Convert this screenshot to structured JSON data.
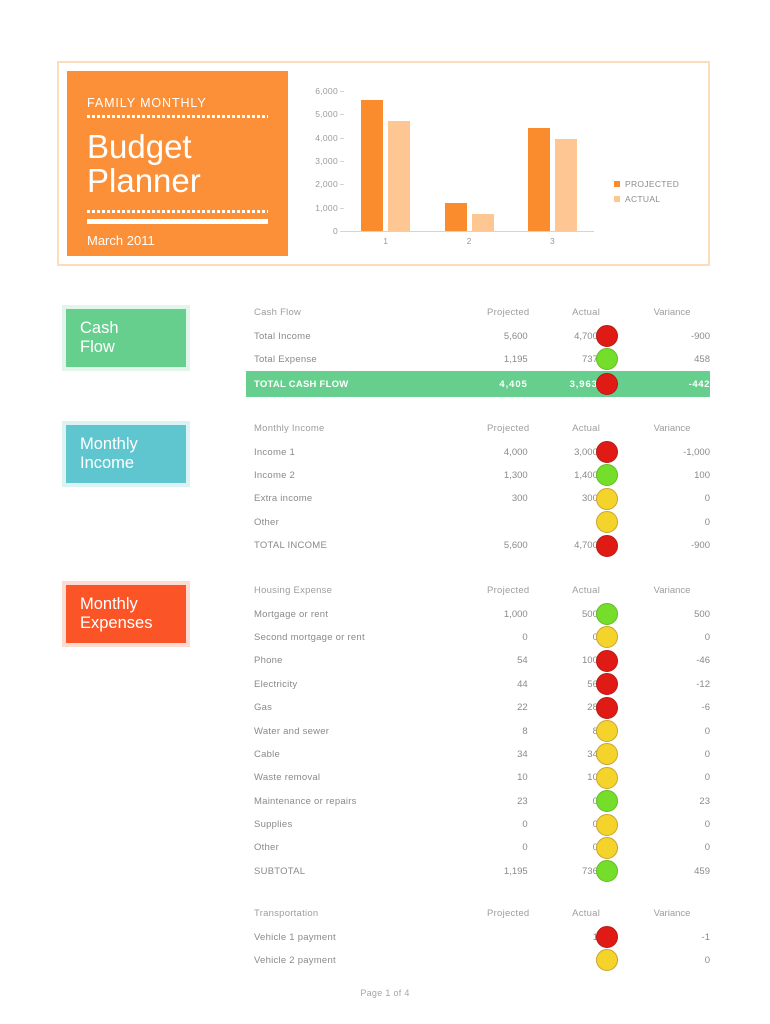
{
  "header": {
    "kicker": "FAMILY MONTHLY",
    "title_line1": "Budget",
    "title_line2": "Planner",
    "date": "March 2011"
  },
  "chart_data": {
    "type": "bar",
    "title": "",
    "xlabel": "",
    "ylabel": "",
    "categories": [
      "1",
      "2",
      "3"
    ],
    "category_meaning": [
      "Total Income",
      "Total Expense",
      "Total Cash Flow"
    ],
    "series": [
      {
        "name": "PROJECTED",
        "color": "#fb8c2d",
        "values": [
          5600,
          1195,
          4405
        ]
      },
      {
        "name": "ACTUAL",
        "color": "#fdc692",
        "values": [
          4700,
          737,
          3963
        ]
      }
    ],
    "ylim": [
      0,
      6000
    ],
    "yticks": [
      "0",
      "1,000",
      "2,000",
      "3,000",
      "4,000",
      "5,000",
      "6,000"
    ],
    "ytick_values": [
      0,
      1000,
      2000,
      3000,
      4000,
      5000,
      6000
    ],
    "grid": false,
    "legend_position": "right"
  },
  "sidebar": {
    "chips": [
      {
        "name": "cash-flow",
        "label": "Cash\nFlow",
        "color": "#66cf8e",
        "border": "#e2f5ea"
      },
      {
        "name": "monthly-income",
        "label": "Monthly\nIncome",
        "color": "#5fc6cf",
        "border": "#dcf2f3"
      },
      {
        "name": "monthly-expenses",
        "label": "Monthly\nExpenses",
        "color": "#fb5527",
        "border": "#fcdcd2"
      }
    ]
  },
  "columns": {
    "projected": "Projected",
    "actual": "Actual",
    "variance": "Variance"
  },
  "tables": {
    "cash_flow": {
      "heading": "Cash Flow",
      "rows": [
        {
          "label": "Total Income",
          "projected": "5,600",
          "actual": "4,700",
          "indicator": "red",
          "variance": "-900"
        },
        {
          "label": "Total Expense",
          "projected": "1,195",
          "actual": "737",
          "indicator": "green",
          "variance": "458"
        }
      ],
      "total": {
        "label": "TOTAL CASH FLOW",
        "projected": "4,405",
        "actual": "3,963",
        "indicator": "red",
        "variance": "-442"
      }
    },
    "monthly_income": {
      "heading": "Monthly Income",
      "rows": [
        {
          "label": "Income 1",
          "projected": "4,000",
          "actual": "3,000",
          "indicator": "red",
          "variance": "-1,000"
        },
        {
          "label": "Income 2",
          "projected": "1,300",
          "actual": "1,400",
          "indicator": "green",
          "variance": "100"
        },
        {
          "label": "Extra income",
          "projected": "300",
          "actual": "300",
          "indicator": "yellow",
          "variance": "0"
        },
        {
          "label": "Other",
          "projected": "",
          "actual": "",
          "indicator": "yellow",
          "variance": "0"
        },
        {
          "label": "TOTAL INCOME",
          "projected": "5,600",
          "actual": "4,700",
          "indicator": "red",
          "variance": "-900"
        }
      ]
    },
    "housing_expense": {
      "heading": "Housing Expense",
      "rows": [
        {
          "label": "Mortgage or rent",
          "projected": "1,000",
          "actual": "500",
          "indicator": "green",
          "variance": "500"
        },
        {
          "label": "Second mortgage or rent",
          "projected": "0",
          "actual": "0",
          "indicator": "yellow",
          "variance": "0"
        },
        {
          "label": "Phone",
          "projected": "54",
          "actual": "100",
          "indicator": "red",
          "variance": "-46"
        },
        {
          "label": "Electricity",
          "projected": "44",
          "actual": "56",
          "indicator": "red",
          "variance": "-12"
        },
        {
          "label": "Gas",
          "projected": "22",
          "actual": "28",
          "indicator": "red",
          "variance": "-6"
        },
        {
          "label": "Water and sewer",
          "projected": "8",
          "actual": "8",
          "indicator": "yellow",
          "variance": "0"
        },
        {
          "label": "Cable",
          "projected": "34",
          "actual": "34",
          "indicator": "yellow",
          "variance": "0"
        },
        {
          "label": "Waste removal",
          "projected": "10",
          "actual": "10",
          "indicator": "yellow",
          "variance": "0"
        },
        {
          "label": "Maintenance or repairs",
          "projected": "23",
          "actual": "0",
          "indicator": "green",
          "variance": "23"
        },
        {
          "label": "Supplies",
          "projected": "0",
          "actual": "0",
          "indicator": "yellow",
          "variance": "0"
        },
        {
          "label": "Other",
          "projected": "0",
          "actual": "0",
          "indicator": "yellow",
          "variance": "0"
        },
        {
          "label": "SUBTOTAL",
          "projected": "1,195",
          "actual": "736",
          "indicator": "green",
          "variance": "459"
        }
      ]
    },
    "transportation": {
      "heading": "Transportation",
      "rows": [
        {
          "label": "Vehicle 1 payment",
          "projected": "",
          "actual": "1",
          "indicator": "red",
          "variance": "-1"
        },
        {
          "label": "Vehicle 2 payment",
          "projected": "",
          "actual": "",
          "indicator": "yellow",
          "variance": "0"
        }
      ]
    }
  },
  "footer": {
    "page_label": "Page 1 of 4"
  }
}
